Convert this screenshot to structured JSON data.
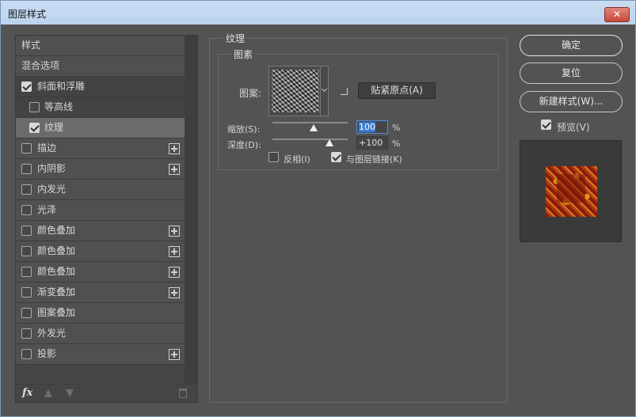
{
  "window": {
    "title": "图层样式",
    "close_symbol": "✕"
  },
  "left": {
    "styles_header": "样式",
    "blend_options": "混合选项",
    "items": [
      {
        "label": "斜面和浮雕",
        "checked": true,
        "sub": false,
        "plus": false
      },
      {
        "label": "等高线",
        "checked": false,
        "sub": true,
        "plus": false
      },
      {
        "label": "纹理",
        "checked": true,
        "sub": true,
        "plus": false
      },
      {
        "label": "描边",
        "checked": false,
        "sub": false,
        "plus": true
      },
      {
        "label": "内阴影",
        "checked": false,
        "sub": false,
        "plus": true
      },
      {
        "label": "内发光",
        "checked": false,
        "sub": false,
        "plus": false
      },
      {
        "label": "光泽",
        "checked": false,
        "sub": false,
        "plus": false
      },
      {
        "label": "颜色叠加",
        "checked": false,
        "sub": false,
        "plus": true
      },
      {
        "label": "颜色叠加",
        "checked": false,
        "sub": false,
        "plus": true
      },
      {
        "label": "颜色叠加",
        "checked": false,
        "sub": false,
        "plus": true
      },
      {
        "label": "渐变叠加",
        "checked": false,
        "sub": false,
        "plus": true
      },
      {
        "label": "图案叠加",
        "checked": false,
        "sub": false,
        "plus": false
      },
      {
        "label": "外发光",
        "checked": false,
        "sub": false,
        "plus": false
      },
      {
        "label": "投影",
        "checked": false,
        "sub": false,
        "plus": true
      }
    ],
    "fx_label": "fx"
  },
  "texture": {
    "group_title": "纹理",
    "subgroup_title": "图素",
    "pattern_label": "图案:",
    "snap_button": "贴紧原点(A)",
    "scale_label": "缩放(S):",
    "scale_value": "100",
    "scale_percent": 0.55,
    "depth_label": "深度(D):",
    "depth_value": "+100",
    "depth_percent": 0.76,
    "percent_sign": "%",
    "invert_label": "反相(I)",
    "invert_checked": false,
    "link_label": "与图层链接(K)",
    "link_checked": true
  },
  "right": {
    "ok": "确定",
    "reset": "复位",
    "new_style": "新建样式(W)...",
    "preview_label": "预览(V)",
    "preview_checked": true
  }
}
